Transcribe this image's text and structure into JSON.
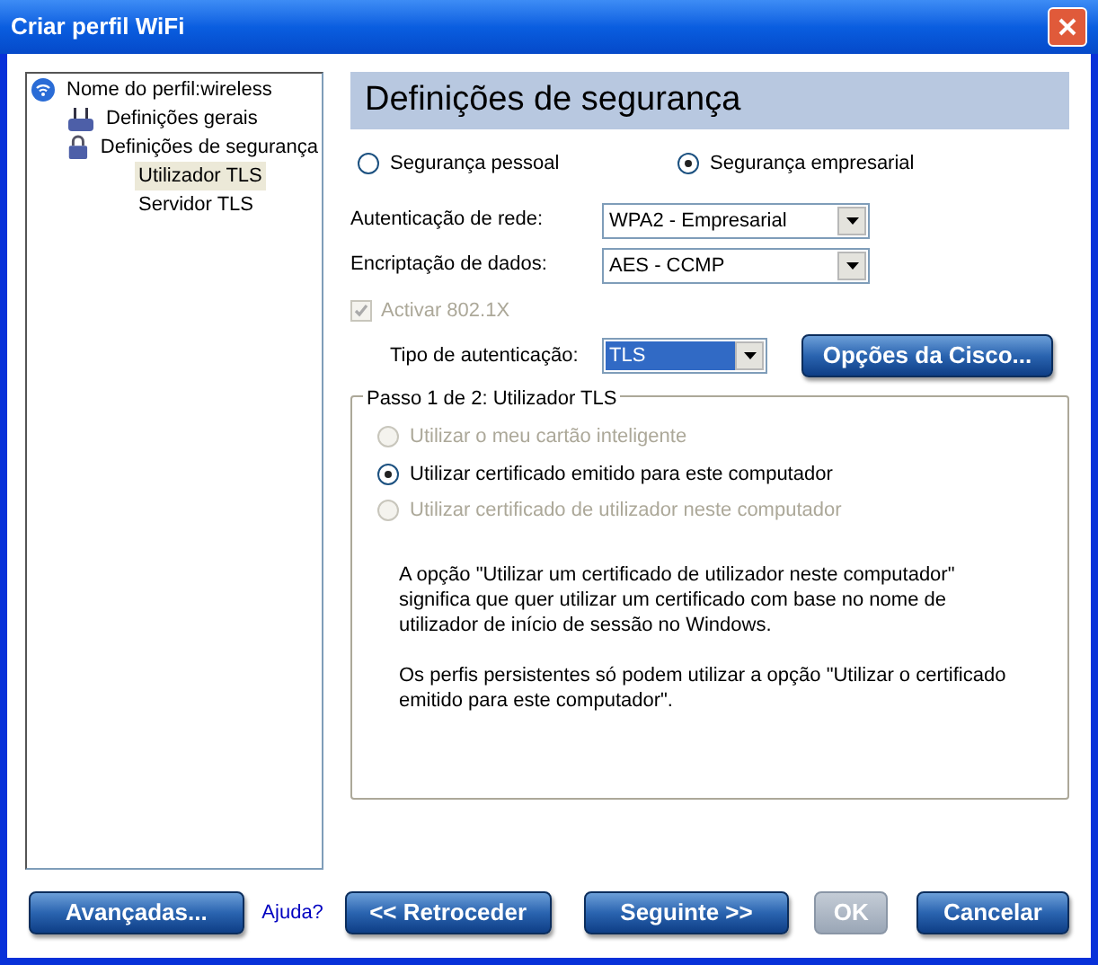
{
  "window": {
    "title": "Criar perfil WiFi"
  },
  "tree": [
    {
      "label": "Nome do perfil:wireless",
      "selected": false,
      "children": [
        {
          "label": "Definições gerais",
          "selected": false
        },
        {
          "label": "Definições de segurança",
          "selected": false,
          "children": [
            {
              "label": "Utilizador TLS",
              "selected": true
            },
            {
              "label": "Servidor TLS",
              "selected": false
            }
          ]
        }
      ]
    }
  ],
  "heading": "Definições de segurança",
  "security_modes": [
    {
      "label": "Segurança pessoal",
      "selected": false
    },
    {
      "label": "Segurança empresarial",
      "selected": true
    }
  ],
  "fields": [
    {
      "label": "Autenticação de rede:",
      "value": "WPA2 - Empresarial"
    },
    {
      "label": "Encriptação de dados:",
      "value": "AES - CCMP"
    }
  ],
  "enable_8021x": {
    "label": "Activar 802.1X",
    "checked": true,
    "disabled": true
  },
  "auth_type": {
    "label": "Tipo de autenticação:",
    "value": "TLS"
  },
  "cisco_button": "Opções da Cisco...",
  "group": {
    "title": "Passo 1 de 2: Utilizador TLS",
    "options": [
      {
        "label": "Utilizar o meu cartão inteligente",
        "selected": false,
        "disabled": true
      },
      {
        "label": "Utilizar certificado emitido para este computador",
        "selected": true,
        "disabled": false
      },
      {
        "label": "Utilizar certificado de utilizador neste computador",
        "selected": false,
        "disabled": true
      }
    ],
    "notes": [
      "A opção \"Utilizar um certificado de utilizador neste computador\" significa que quer utilizar um certificado com base no nome de utilizador de início de sessão no Windows.",
      "Os perfis persistentes só podem utilizar a opção \"Utilizar o certificado emitido para este computador\"."
    ]
  },
  "buttons": [
    {
      "kind": "button",
      "label": "Avançadas...",
      "disabled": false
    },
    {
      "kind": "link",
      "label": "Ajuda?",
      "disabled": false
    },
    {
      "kind": "button",
      "label": "<< Retroceder",
      "disabled": false
    },
    {
      "kind": "button",
      "label": "Seguinte >>",
      "disabled": false
    },
    {
      "kind": "button",
      "label": "OK",
      "disabled": true
    },
    {
      "kind": "button",
      "label": "Cancelar",
      "disabled": false
    }
  ]
}
